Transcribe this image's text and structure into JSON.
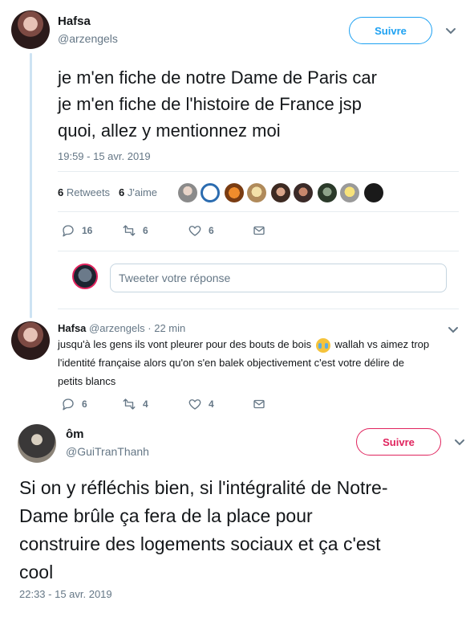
{
  "tweet1": {
    "name": "Hafsa",
    "handle": "@arzengels",
    "follow_label": "Suivre",
    "text_lines": [
      "je m'en fiche de notre Dame de Paris car",
      "je m'en fiche de l'histoire de France jsp",
      "quoi, allez y mentionnez moi"
    ],
    "timestamp": "19:59 - 15 avr. 2019",
    "stats": {
      "retweets_count": "6",
      "retweets_label": "Retweets",
      "likes_count": "6",
      "likes_label": "J'aime"
    },
    "actions": {
      "reply_count": "16",
      "retweet_count": "6",
      "like_count": "6"
    },
    "reply_placeholder": "Tweeter votre réponse"
  },
  "reply": {
    "name": "Hafsa",
    "handle": "@arzengels",
    "time": "22 min",
    "text_part1": "jusqu'à les gens ils vont pleurer pour des bouts de bois",
    "text_part2": "wallah vs aimez trop",
    "text_line2": "l'identité française alors qu'on s'en balek objectivement c'est votre délire de",
    "text_line3": "petits blancs",
    "actions": {
      "reply_count": "6",
      "retweet_count": "4",
      "like_count": "4"
    }
  },
  "tweet2": {
    "name": "ôm",
    "handle": "@GuiTranThanh",
    "follow_label": "Suivre",
    "text_lines": [
      "Si on y réfléchis bien, si l'intégralité de Notre-",
      "Dame brûle ça fera de la place pour",
      "construire des logements sociaux et ça c'est",
      "cool"
    ],
    "timestamp": "22:33 - 15 avr. 2019"
  },
  "colors": {
    "accent_blue": "#1da1f2",
    "follow_red": "#e0245e",
    "muted": "#657786",
    "thread_line": "#cde3f3"
  },
  "icons": [
    "reply-icon",
    "retweet-icon",
    "heart-icon",
    "message-icon",
    "chevron-down-icon",
    "crying-face-emoji"
  ]
}
